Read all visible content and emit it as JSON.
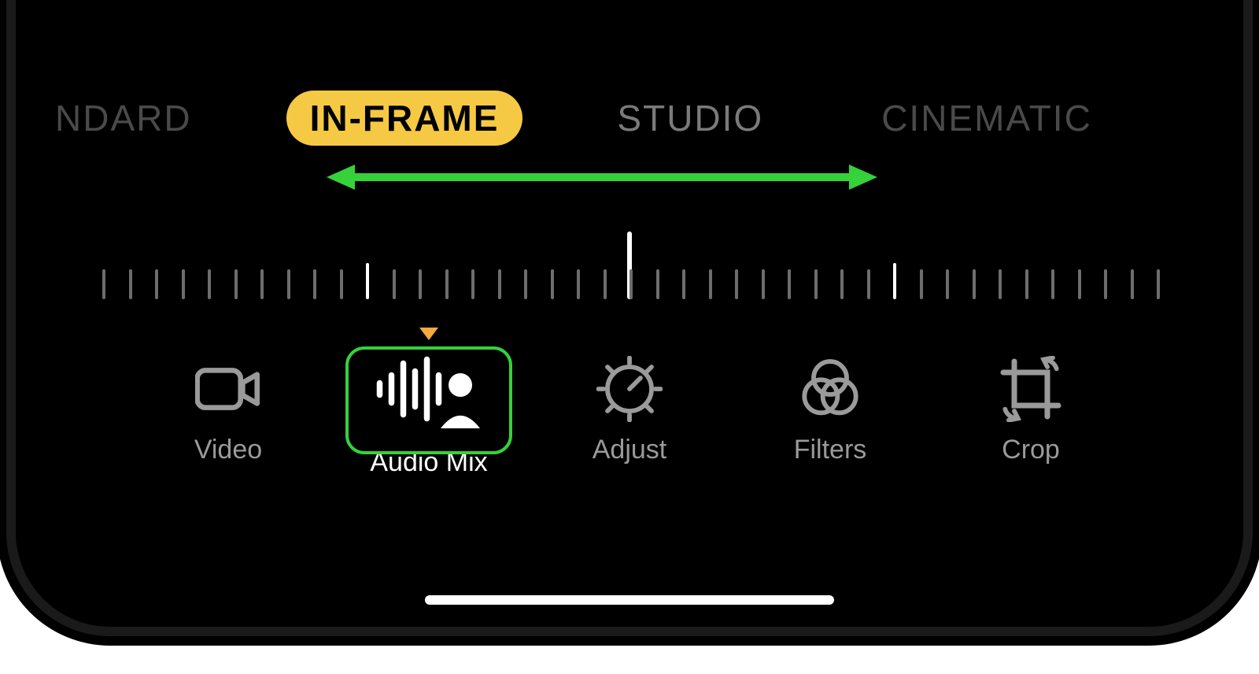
{
  "modes": {
    "standard": "NDARD",
    "in_frame": "IN-FRAME",
    "studio": "STUDIO",
    "cinematic": "CINEMATIC",
    "selected": "in_frame"
  },
  "dial": {
    "tick_count": 41,
    "major_indices": [
      10,
      30
    ],
    "center_index": 20
  },
  "tools": {
    "video": {
      "label": "Video"
    },
    "audio_mix": {
      "label": "Audio Mix"
    },
    "adjust": {
      "label": "Adjust"
    },
    "filters": {
      "label": "Filters"
    },
    "crop": {
      "label": "Crop"
    },
    "active": "audio_mix"
  },
  "annotation": {
    "arrow_color": "#35d23a",
    "highlight_color": "#35d23a"
  }
}
